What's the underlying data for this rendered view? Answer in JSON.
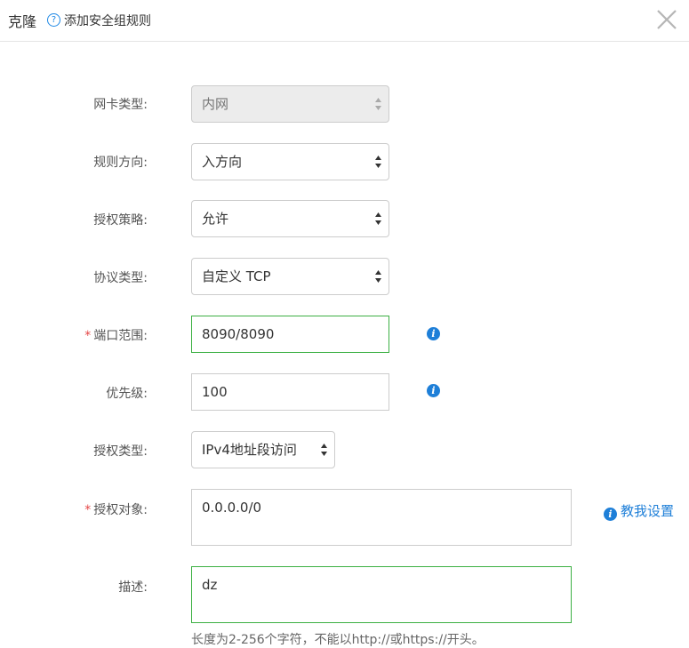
{
  "header": {
    "title": "克隆",
    "help_glyph": "?",
    "subtitle": "添加安全组规则",
    "close_icon": "close-icon"
  },
  "form": {
    "nic_type": {
      "label": "网卡类型:",
      "value": "内网",
      "disabled": true
    },
    "direction": {
      "label": "规则方向:",
      "value": "入方向"
    },
    "policy": {
      "label": "授权策略:",
      "value": "允许"
    },
    "protocol": {
      "label": "协议类型:",
      "value": "自定义 TCP"
    },
    "port_range": {
      "required_mark": "*",
      "label": "端口范围:",
      "value": "8090/8090"
    },
    "priority": {
      "label": "优先级:",
      "value": "100"
    },
    "auth_type": {
      "label": "授权类型:",
      "value": "IPv4地址段访问"
    },
    "auth_object": {
      "required_mark": "*",
      "label": "授权对象:",
      "value": "0.0.0.0/0",
      "help_link": "教我设置"
    },
    "description": {
      "label": "描述:",
      "value": "dz",
      "hint": "长度为2-256个字符，不能以http://或https://开头。"
    }
  },
  "colors": {
    "accent": "#1e7fd8",
    "valid_border": "#3cb043",
    "required": "#e54646"
  }
}
